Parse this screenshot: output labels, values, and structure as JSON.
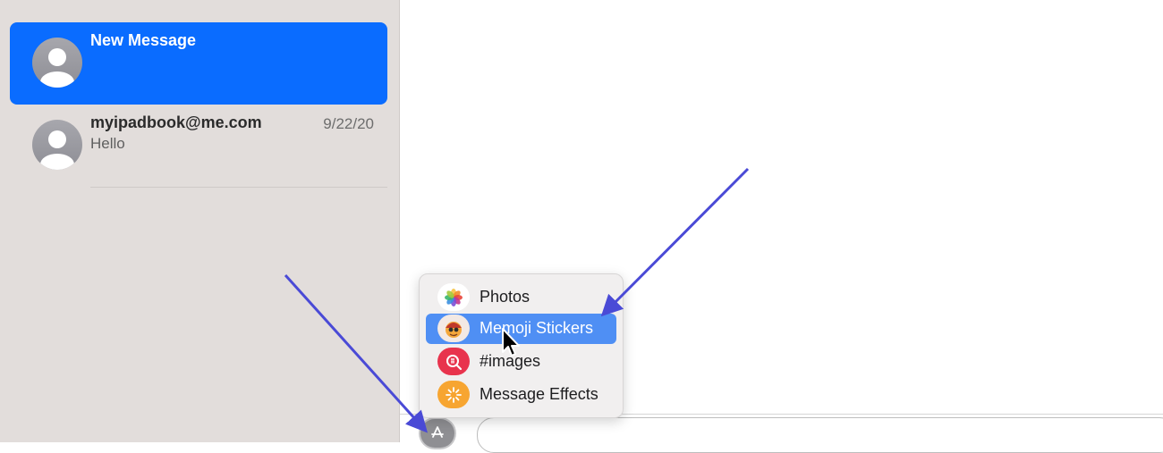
{
  "sidebar": {
    "conversations": [
      {
        "name": "New Message",
        "date": "",
        "preview": ""
      },
      {
        "name": "myipadbook@me.com",
        "date": "9/22/20",
        "preview": "Hello"
      }
    ]
  },
  "apps_menu": {
    "items": [
      {
        "label": "Photos",
        "icon": "photos-icon"
      },
      {
        "label": "Memoji Stickers",
        "icon": "memoji-stickers-icon",
        "highlighted": true
      },
      {
        "label": "#images",
        "icon": "images-search-icon"
      },
      {
        "label": "Message Effects",
        "icon": "message-effects-icon"
      }
    ]
  },
  "composer": {
    "apps_button_icon": "app-store-icon",
    "message_placeholder": ""
  },
  "colors": {
    "selection_blue": "#0a6cff",
    "menu_highlight": "#4f8ff4",
    "annotation_arrow": "#4a4ad6"
  }
}
